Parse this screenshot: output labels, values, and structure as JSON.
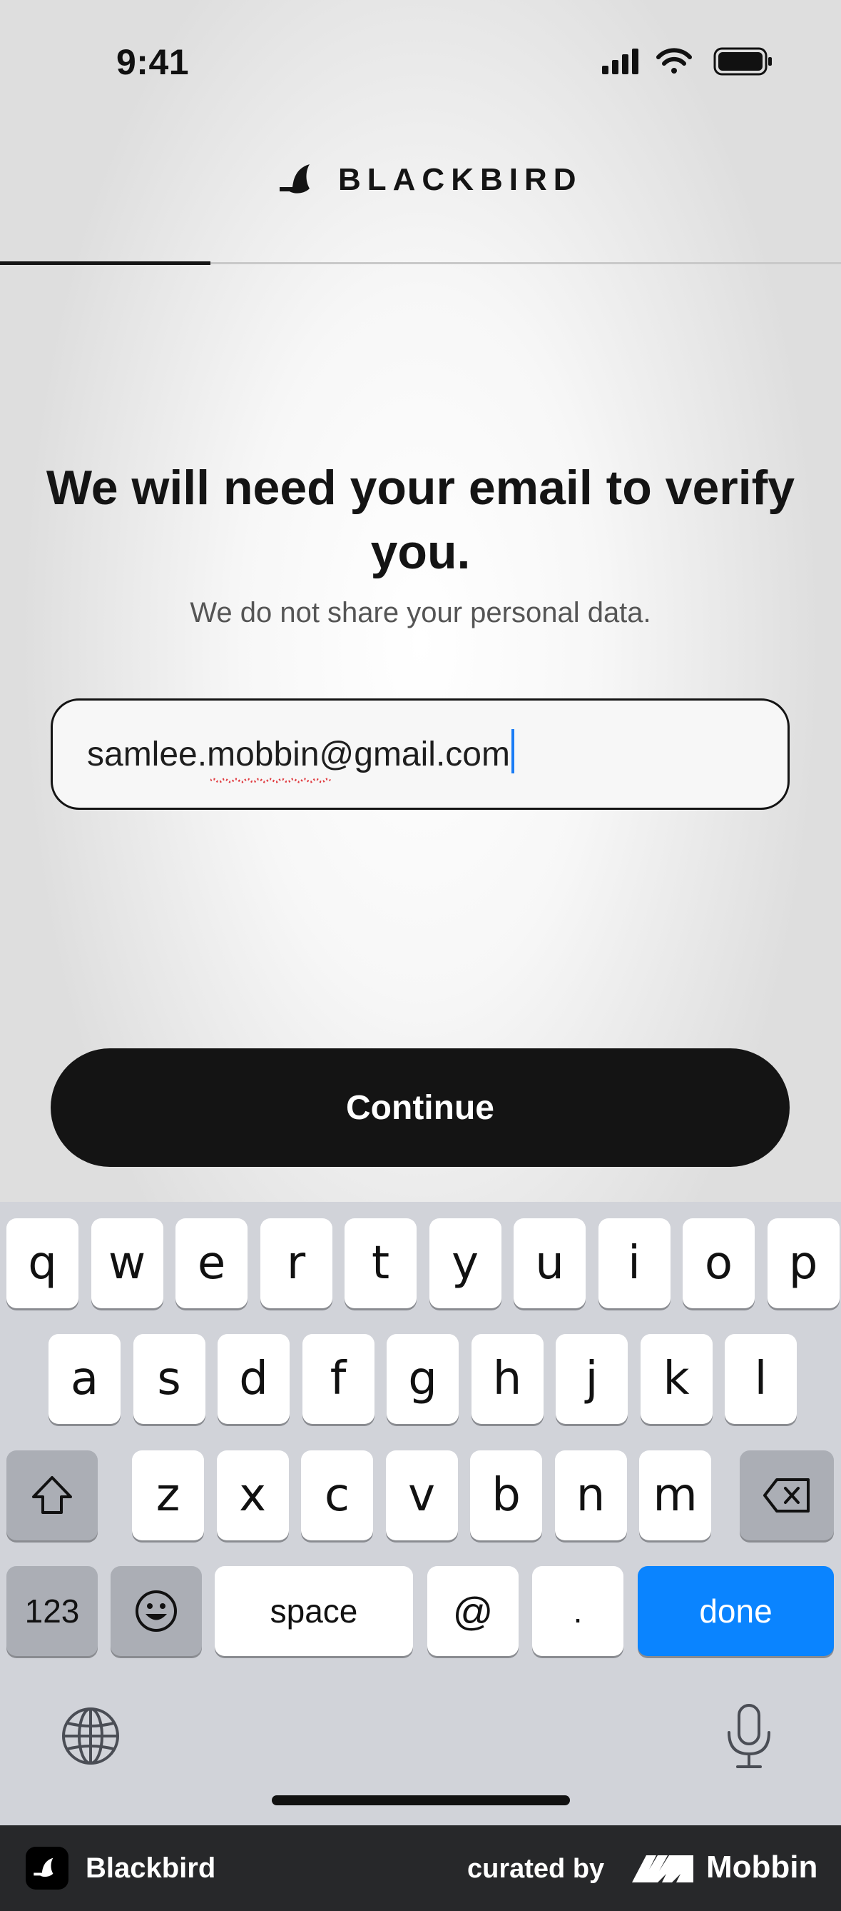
{
  "status_bar": {
    "time": "9:41",
    "icons": [
      "cellular-signal-icon",
      "wifi-icon",
      "battery-icon"
    ]
  },
  "header": {
    "brand": "BLACKBIRD",
    "logo_icon": "blackbird-logo-icon",
    "progress": 0.25
  },
  "main": {
    "heading": "We will need your email to verify you.",
    "subheading": "We do not share your personal data.",
    "email": {
      "value": "samlee.mobbin@gmail.com",
      "value_prefix": "samlee.",
      "value_flagged": "mobbin",
      "value_suffix": "@gmail.com"
    },
    "continue_label": "Continue"
  },
  "keyboard": {
    "row1": [
      "q",
      "w",
      "e",
      "r",
      "t",
      "y",
      "u",
      "i",
      "o",
      "p"
    ],
    "row2": [
      "a",
      "s",
      "d",
      "f",
      "g",
      "h",
      "j",
      "k",
      "l"
    ],
    "row3": [
      "z",
      "x",
      "c",
      "v",
      "b",
      "n",
      "m"
    ],
    "numbers_label": "123",
    "space_label": "space",
    "at_label": "@",
    "dot_label": ".",
    "done_label": "done"
  },
  "footer": {
    "app_name": "Blackbird",
    "curated_by": "curated by",
    "curator": "Mobbin"
  },
  "colors": {
    "primary": "#141414",
    "accent": "#0a84ff",
    "keyboard_bg": "#d1d3d9",
    "footer_bg": "#27282a"
  }
}
